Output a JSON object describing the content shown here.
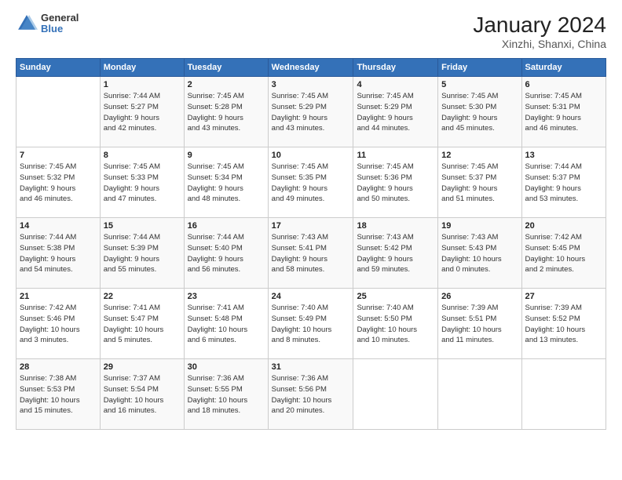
{
  "header": {
    "logo_line1": "General",
    "logo_line2": "Blue",
    "month_title": "January 2024",
    "location": "Xinzhi, Shanxi, China"
  },
  "days_of_week": [
    "Sunday",
    "Monday",
    "Tuesday",
    "Wednesday",
    "Thursday",
    "Friday",
    "Saturday"
  ],
  "weeks": [
    [
      {
        "num": "",
        "info": ""
      },
      {
        "num": "1",
        "info": "Sunrise: 7:44 AM\nSunset: 5:27 PM\nDaylight: 9 hours\nand 42 minutes."
      },
      {
        "num": "2",
        "info": "Sunrise: 7:45 AM\nSunset: 5:28 PM\nDaylight: 9 hours\nand 43 minutes."
      },
      {
        "num": "3",
        "info": "Sunrise: 7:45 AM\nSunset: 5:29 PM\nDaylight: 9 hours\nand 43 minutes."
      },
      {
        "num": "4",
        "info": "Sunrise: 7:45 AM\nSunset: 5:29 PM\nDaylight: 9 hours\nand 44 minutes."
      },
      {
        "num": "5",
        "info": "Sunrise: 7:45 AM\nSunset: 5:30 PM\nDaylight: 9 hours\nand 45 minutes."
      },
      {
        "num": "6",
        "info": "Sunrise: 7:45 AM\nSunset: 5:31 PM\nDaylight: 9 hours\nand 46 minutes."
      }
    ],
    [
      {
        "num": "7",
        "info": "Sunrise: 7:45 AM\nSunset: 5:32 PM\nDaylight: 9 hours\nand 46 minutes."
      },
      {
        "num": "8",
        "info": "Sunrise: 7:45 AM\nSunset: 5:33 PM\nDaylight: 9 hours\nand 47 minutes."
      },
      {
        "num": "9",
        "info": "Sunrise: 7:45 AM\nSunset: 5:34 PM\nDaylight: 9 hours\nand 48 minutes."
      },
      {
        "num": "10",
        "info": "Sunrise: 7:45 AM\nSunset: 5:35 PM\nDaylight: 9 hours\nand 49 minutes."
      },
      {
        "num": "11",
        "info": "Sunrise: 7:45 AM\nSunset: 5:36 PM\nDaylight: 9 hours\nand 50 minutes."
      },
      {
        "num": "12",
        "info": "Sunrise: 7:45 AM\nSunset: 5:37 PM\nDaylight: 9 hours\nand 51 minutes."
      },
      {
        "num": "13",
        "info": "Sunrise: 7:44 AM\nSunset: 5:37 PM\nDaylight: 9 hours\nand 53 minutes."
      }
    ],
    [
      {
        "num": "14",
        "info": "Sunrise: 7:44 AM\nSunset: 5:38 PM\nDaylight: 9 hours\nand 54 minutes."
      },
      {
        "num": "15",
        "info": "Sunrise: 7:44 AM\nSunset: 5:39 PM\nDaylight: 9 hours\nand 55 minutes."
      },
      {
        "num": "16",
        "info": "Sunrise: 7:44 AM\nSunset: 5:40 PM\nDaylight: 9 hours\nand 56 minutes."
      },
      {
        "num": "17",
        "info": "Sunrise: 7:43 AM\nSunset: 5:41 PM\nDaylight: 9 hours\nand 58 minutes."
      },
      {
        "num": "18",
        "info": "Sunrise: 7:43 AM\nSunset: 5:42 PM\nDaylight: 9 hours\nand 59 minutes."
      },
      {
        "num": "19",
        "info": "Sunrise: 7:43 AM\nSunset: 5:43 PM\nDaylight: 10 hours\nand 0 minutes."
      },
      {
        "num": "20",
        "info": "Sunrise: 7:42 AM\nSunset: 5:45 PM\nDaylight: 10 hours\nand 2 minutes."
      }
    ],
    [
      {
        "num": "21",
        "info": "Sunrise: 7:42 AM\nSunset: 5:46 PM\nDaylight: 10 hours\nand 3 minutes."
      },
      {
        "num": "22",
        "info": "Sunrise: 7:41 AM\nSunset: 5:47 PM\nDaylight: 10 hours\nand 5 minutes."
      },
      {
        "num": "23",
        "info": "Sunrise: 7:41 AM\nSunset: 5:48 PM\nDaylight: 10 hours\nand 6 minutes."
      },
      {
        "num": "24",
        "info": "Sunrise: 7:40 AM\nSunset: 5:49 PM\nDaylight: 10 hours\nand 8 minutes."
      },
      {
        "num": "25",
        "info": "Sunrise: 7:40 AM\nSunset: 5:50 PM\nDaylight: 10 hours\nand 10 minutes."
      },
      {
        "num": "26",
        "info": "Sunrise: 7:39 AM\nSunset: 5:51 PM\nDaylight: 10 hours\nand 11 minutes."
      },
      {
        "num": "27",
        "info": "Sunrise: 7:39 AM\nSunset: 5:52 PM\nDaylight: 10 hours\nand 13 minutes."
      }
    ],
    [
      {
        "num": "28",
        "info": "Sunrise: 7:38 AM\nSunset: 5:53 PM\nDaylight: 10 hours\nand 15 minutes."
      },
      {
        "num": "29",
        "info": "Sunrise: 7:37 AM\nSunset: 5:54 PM\nDaylight: 10 hours\nand 16 minutes."
      },
      {
        "num": "30",
        "info": "Sunrise: 7:36 AM\nSunset: 5:55 PM\nDaylight: 10 hours\nand 18 minutes."
      },
      {
        "num": "31",
        "info": "Sunrise: 7:36 AM\nSunset: 5:56 PM\nDaylight: 10 hours\nand 20 minutes."
      },
      {
        "num": "",
        "info": ""
      },
      {
        "num": "",
        "info": ""
      },
      {
        "num": "",
        "info": ""
      }
    ]
  ]
}
